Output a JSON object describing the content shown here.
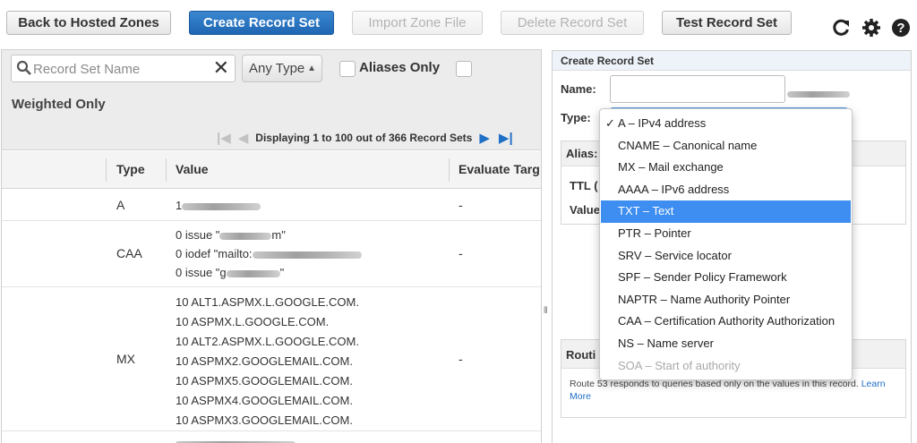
{
  "toolbar": {
    "back_label": "Back to Hosted Zones",
    "create_label": "Create Record Set",
    "import_label": "Import Zone File",
    "delete_label": "Delete Record Set",
    "test_label": "Test Record Set",
    "icons": [
      "refresh-icon",
      "gear-icon",
      "help-icon"
    ]
  },
  "filters": {
    "search_placeholder": "Record Set Name",
    "type_value": "Any Type",
    "aliases_label": "Aliases Only",
    "weighted_label": "Weighted Only"
  },
  "pager": {
    "text": "Displaying 1 to 100 out of 366 Record Sets"
  },
  "table": {
    "headers": {
      "type": "Type",
      "value": "Value",
      "evaluate": "Evaluate Targ"
    },
    "rows": [
      {
        "type": "A",
        "values": [
          "1"
        ],
        "evaluate": "-"
      },
      {
        "type": "CAA",
        "values": [
          "0 issue \"",
          "0 iodef \"mailto:",
          "0 issue \"g"
        ],
        "value_suffixes": [
          "m\"",
          "",
          "\""
        ],
        "evaluate": "-"
      },
      {
        "type": "MX",
        "values": [
          "10 ALT1.ASPMX.L.GOOGLE.COM.",
          "10 ASPMX.L.GOOGLE.COM.",
          "10 ALT2.ASPMX.L.GOOGLE.COM.",
          "10 ASPMX2.GOOGLEMAIL.COM.",
          "10 ASPMX5.GOOGLEMAIL.COM.",
          "10 ASPMX4.GOOGLEMAIL.COM.",
          "10 ASPMX3.GOOGLEMAIL.COM."
        ],
        "evaluate": "-"
      }
    ]
  },
  "panel": {
    "title": "Create Record Set",
    "name_label": "Name:",
    "type_label": "Type:",
    "alias_label": "Alias:",
    "ttl_label": "TTL (",
    "value_label": "Value",
    "routing_label": "Routi",
    "routing_text": "Route 53 responds to queries based only on the values in this record.",
    "learn_more": "Learn More"
  },
  "type_options": [
    {
      "label": "A – IPv4 address",
      "checked": true
    },
    {
      "label": "CNAME – Canonical name"
    },
    {
      "label": "MX – Mail exchange"
    },
    {
      "label": "AAAA – IPv6 address"
    },
    {
      "label": "TXT – Text",
      "highlighted": true
    },
    {
      "label": "PTR – Pointer"
    },
    {
      "label": "SRV – Service locator"
    },
    {
      "label": "SPF – Sender Policy Framework"
    },
    {
      "label": "NAPTR – Name Authority Pointer"
    },
    {
      "label": "CAA – Certification Authority Authorization"
    },
    {
      "label": "NS – Name server"
    },
    {
      "label": "SOA – Start of authority",
      "disabled": true
    }
  ],
  "colors": {
    "primary": "#1f66b3",
    "highlight": "#3d8ef0",
    "link": "#1f6fc6"
  }
}
